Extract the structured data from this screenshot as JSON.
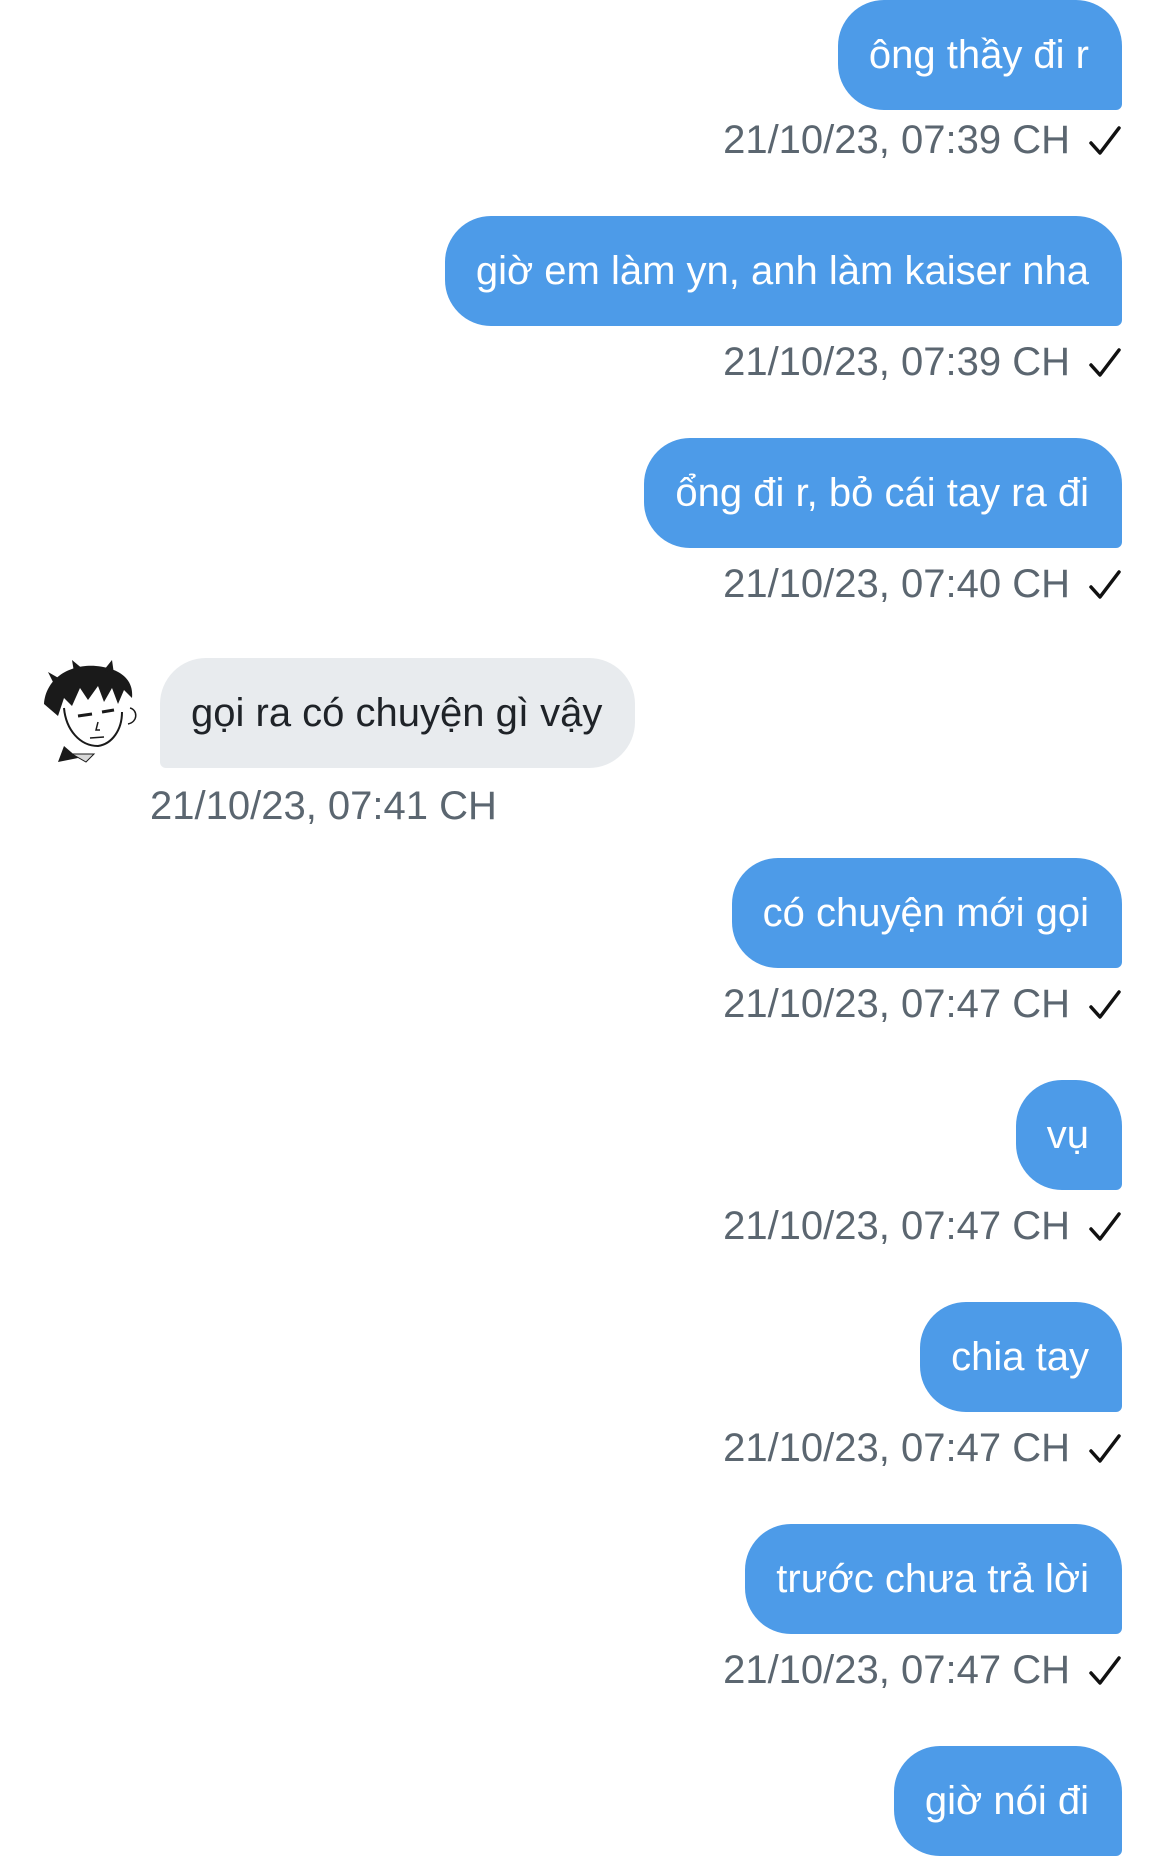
{
  "colors": {
    "outgoing_bubble": "#4d9be8",
    "incoming_bubble": "#e8ebee",
    "meta_text": "#5b6670"
  },
  "messages": [
    {
      "direction": "out",
      "text": "ông thầy đi r",
      "time": "21/10/23, 07:39 CH",
      "status_icon": "checkmark-icon"
    },
    {
      "direction": "out",
      "text": "giờ em làm yn, anh làm kaiser nha",
      "time": "21/10/23, 07:39 CH",
      "status_icon": "checkmark-icon"
    },
    {
      "direction": "out",
      "text": "ổng đi r, bỏ cái tay ra đi",
      "time": "21/10/23, 07:40 CH",
      "status_icon": "checkmark-icon"
    },
    {
      "direction": "in",
      "text": "gọi ra có chuyện gì vậy",
      "time": "21/10/23, 07:41 CH",
      "avatar_icon": "manga-character-avatar"
    },
    {
      "direction": "out",
      "text": "có chuyện mới gọi",
      "time": "21/10/23, 07:47 CH",
      "status_icon": "checkmark-icon"
    },
    {
      "direction": "out",
      "text": "vụ",
      "time": "21/10/23, 07:47 CH",
      "status_icon": "checkmark-icon"
    },
    {
      "direction": "out",
      "text": "chia tay",
      "time": "21/10/23, 07:47 CH",
      "status_icon": "checkmark-icon"
    },
    {
      "direction": "out",
      "text": "trước chưa trả lời",
      "time": "21/10/23, 07:47 CH",
      "status_icon": "checkmark-icon"
    },
    {
      "direction": "out",
      "text": "giờ nói đi"
    }
  ]
}
